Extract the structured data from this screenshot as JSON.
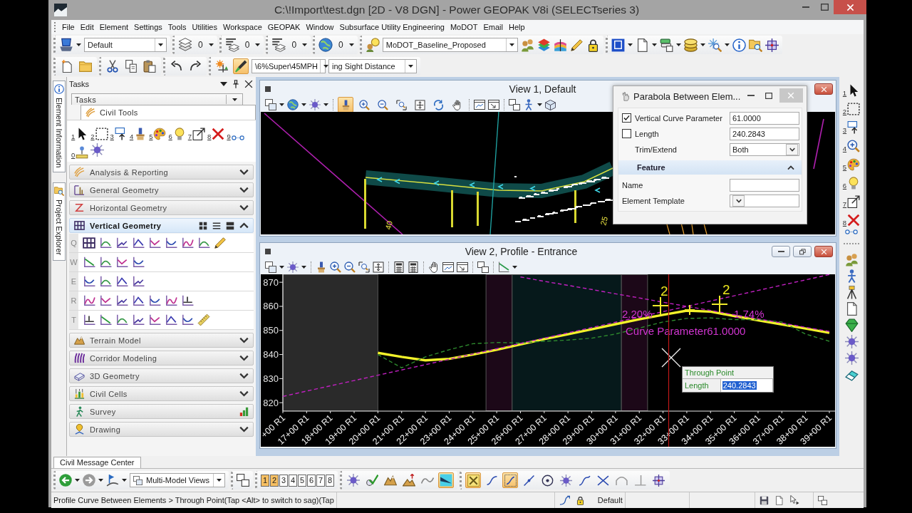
{
  "window": {
    "title": "C:\\!Import\\test.dgn [2D - V8 DGN] - Power GEOPAK V8i (SELECTseries 3)"
  },
  "menu": [
    "File",
    "Edit",
    "Element",
    "Settings",
    "Tools",
    "Utilities",
    "Workspace",
    "GEOPAK",
    "Window",
    "Subsurface Utility Engineering",
    "MoDOT",
    "Email",
    "Help"
  ],
  "toolbar_1": {
    "model_dropdown": "Default",
    "counts": [
      "0",
      "0",
      "0",
      "0"
    ],
    "template_dropdown": "MoDOT_Baseline_Proposed"
  },
  "toolbar_2": {
    "tools": [
      {
        "on": false
      },
      {
        "on": false
      },
      {
        "on": false
      },
      {
        "on": false
      },
      {
        "on": false
      },
      {
        "on": false
      },
      {
        "on": false
      },
      {
        "on": false
      },
      {
        "on": true
      }
    ],
    "dropdowns": [
      "\\6%Super\\45MPH",
      "ing Sight Distance"
    ]
  },
  "side_tabs": [
    "Element Information",
    "Project Explorer"
  ],
  "tasks": {
    "title": "Tasks",
    "dropdown": "Tasks",
    "tab": "Civil Tools",
    "tool_keys": [
      "1",
      "2",
      "3",
      "4",
      "5",
      "6",
      "7",
      "8",
      "9",
      "0"
    ],
    "sections": [
      {
        "label": "Analysis & Reporting",
        "expanded": false
      },
      {
        "label": "General Geometry",
        "expanded": false
      },
      {
        "label": "Horizontal Geometry",
        "expanded": false
      },
      {
        "label": "Vertical Geometry",
        "expanded": true,
        "rows": [
          "Q",
          "W",
          "E",
          "R",
          "T"
        ]
      },
      {
        "label": "Terrain Model",
        "expanded": false
      },
      {
        "label": "Corridor Modeling",
        "expanded": false
      },
      {
        "label": "3D Geometry",
        "expanded": false
      },
      {
        "label": "Civil Cells",
        "expanded": false
      },
      {
        "label": "Survey",
        "expanded": false
      },
      {
        "label": "Drawing",
        "expanded": false
      }
    ]
  },
  "view_1": {
    "title": "View 1, Default",
    "tools": [
      {
        "on": true
      },
      {
        "on": false
      },
      {
        "on": false
      },
      {
        "on": false
      },
      {
        "on": false
      },
      {
        "on": false
      },
      {
        "on": false
      }
    ],
    "drawing_labels": [
      "40",
      "25"
    ]
  },
  "dialog": {
    "title": "Parabola Between Elem...",
    "fields": [
      {
        "kind": "checkbox",
        "label": "Vertical Curve Parameter",
        "checked": true,
        "value": "61.0000"
      },
      {
        "kind": "checkbox",
        "label": "Length",
        "checked": false,
        "value": "240.2843"
      },
      {
        "kind": "dropdown",
        "label": "Trim/Extend",
        "value": "Both"
      }
    ],
    "section": {
      "title": "Feature",
      "expanded": true,
      "fields": [
        {
          "kind": "text",
          "label": "Name"
        },
        {
          "kind": "dropdown",
          "label": "Element Template"
        }
      ]
    }
  },
  "view_2": {
    "title": "View 2, Profile - Entrance",
    "chart_data": {
      "type": "line",
      "categories": [
        "+00 R1",
        "17+00 R1",
        "18+00 R1",
        "19+00 R1",
        "20+00 R1",
        "21+00 R1",
        "22+00 R1",
        "23+00 R1",
        "24+00 R1",
        "25+00 R1",
        "26+00 R1",
        "27+00 R1",
        "28+00 R1",
        "29+00 R1",
        "30+00 R1",
        "31+00 R1",
        "32+00 R1",
        "33+00 R1",
        "34+00 R1",
        "35+00 R1",
        "36+00 R1",
        "37+00 R1",
        "38+00 R1",
        "39+00 R1"
      ],
      "series": [
        {
          "color": "#f2f22a",
          "values": [
            null,
            null,
            null,
            null,
            840.7,
            839,
            837.6,
            838.2,
            840,
            842,
            844.2,
            846.4,
            848.4,
            850.5,
            852.6,
            854.6,
            856.5,
            858.2,
            857.8,
            856,
            854.2,
            852.5,
            850.8,
            849
          ]
        },
        {
          "color": "#2e8a2e",
          "line_style": "dashed",
          "values": [
            null,
            null,
            null,
            null,
            840,
            834.5,
            839,
            842,
            844.5,
            845,
            844.8,
            845.5,
            846,
            846.8,
            848.5,
            851,
            853.5,
            855,
            855.2,
            854.5,
            854.5,
            853.5,
            848.5,
            845.5
          ]
        },
        {
          "color": "#c020c0",
          "line_style": "dashed",
          "values": [
            822.6,
            824.8,
            827,
            829.2,
            831.4,
            833.6,
            835.8,
            838,
            840.2,
            842.4,
            844.6,
            846.8,
            849,
            851.2,
            853.4,
            855.6,
            857.8,
            860,
            862.2,
            864.4,
            866.6,
            868.8,
            871,
            873.2
          ]
        },
        {
          "color": "#c020c0",
          "line_style": "dashed",
          "values": [
            null,
            null,
            null,
            null,
            null,
            null,
            null,
            null,
            null,
            null,
            872.2,
            870.4,
            868.7,
            867,
            865.2,
            863.5,
            861.7,
            860,
            858.3,
            856.5,
            854.8,
            853.1,
            851.3,
            849.6
          ]
        }
      ],
      "ylim": [
        816.5,
        873.3
      ],
      "yticks": [
        820,
        830,
        840,
        850,
        860,
        870
      ],
      "annotations": [
        "2.20%",
        "1.74%",
        "Curve Parameter61.0000",
        "2",
        "2"
      ]
    },
    "popup": {
      "title": "Through Point",
      "label": "Length",
      "value": "240.2843",
      "value_selected": true
    }
  },
  "right_tool_keys": [
    "1",
    "2",
    "3",
    "4",
    "5",
    "6",
    "7",
    "8"
  ],
  "message_tab": "Civil Message Center",
  "bottom_toolbar": {
    "views_dropdown": "Multi-Model Views",
    "view_buttons": [
      {
        "label": "1",
        "selected": true
      },
      {
        "label": "2",
        "selected": true
      },
      {
        "label": "3",
        "selected": false
      },
      {
        "label": "4",
        "selected": false
      },
      {
        "label": "5",
        "selected": false
      },
      {
        "label": "6",
        "selected": false
      },
      {
        "label": "7",
        "selected": false
      },
      {
        "label": "8",
        "selected": false
      }
    ],
    "tools": [
      {
        "on": false
      },
      {
        "on": false
      },
      {
        "on": false
      },
      {
        "on": false
      },
      {
        "on": false
      },
      {
        "on": true
      }
    ],
    "snap_tools": [
      {
        "on": true
      },
      {
        "on": false
      },
      {
        "on": true
      },
      {
        "on": false
      },
      {
        "on": false
      },
      {
        "on": false
      },
      {
        "on": false
      },
      {
        "on": false
      },
      {
        "on": false
      },
      {
        "on": false
      },
      {
        "on": false
      }
    ]
  },
  "status_bar": {
    "prompt": "Profile Curve Between Elements > Through Point(Tap <Alt> to switch to sag)(Tap",
    "level": "Default"
  }
}
